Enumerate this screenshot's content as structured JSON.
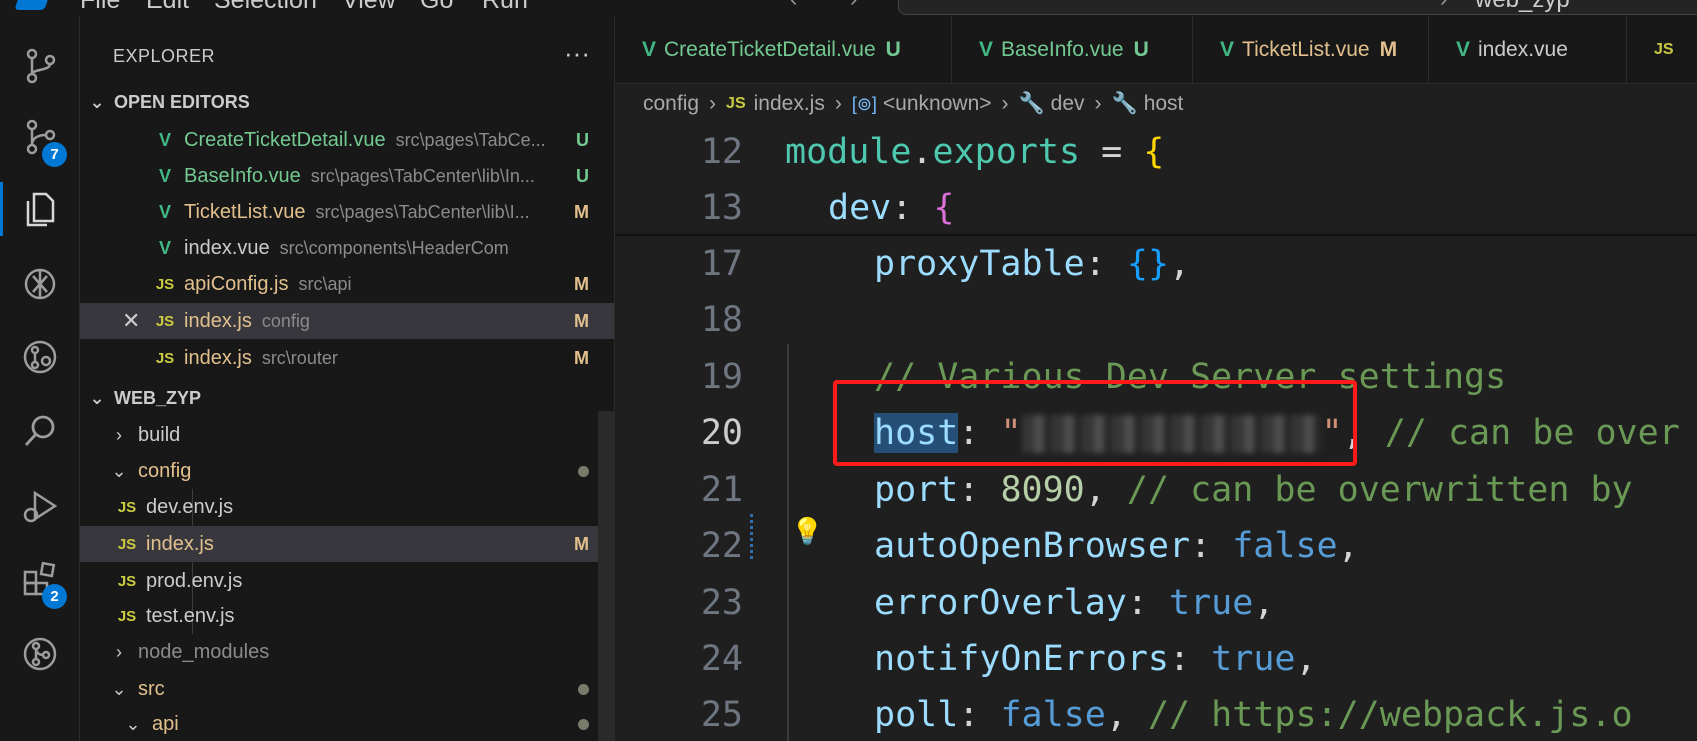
{
  "menu": {
    "items": [
      "File",
      "Edit",
      "Selection",
      "View",
      "Go",
      "Run"
    ],
    "search_text": "web_zyp"
  },
  "activity_bar": {
    "items": [
      {
        "name": "source-control-graph-icon"
      },
      {
        "name": "source-control-icon",
        "badge": "7"
      },
      {
        "name": "explorer-icon",
        "active": true
      },
      {
        "name": "chatgpt-icon"
      },
      {
        "name": "git-lens-icon"
      },
      {
        "name": "search-icon"
      },
      {
        "name": "run-debug-icon"
      },
      {
        "name": "extensions-icon",
        "badge": "2"
      },
      {
        "name": "git-graph-icon"
      }
    ]
  },
  "sidebar": {
    "title": "EXPLORER",
    "more": "···",
    "open_editors": {
      "title": "OPEN EDITORS",
      "items": [
        {
          "name": "CreateTicketDetail.vue",
          "path": "src\\pages\\TabCe...",
          "status": "U",
          "type": "vue"
        },
        {
          "name": "BaseInfo.vue",
          "path": "src\\pages\\TabCenter\\lib\\In...",
          "status": "U",
          "type": "vue"
        },
        {
          "name": "TicketList.vue",
          "path": "src\\pages\\TabCenter\\lib\\I...",
          "status": "M",
          "type": "vue"
        },
        {
          "name": "index.vue",
          "path": "src\\components\\HeaderCom",
          "status": "",
          "type": "vue"
        },
        {
          "name": "apiConfig.js",
          "path": "src\\api",
          "status": "M",
          "type": "js"
        },
        {
          "name": "index.js",
          "path": "config",
          "status": "M",
          "type": "js",
          "active": true
        },
        {
          "name": "index.js",
          "path": "src\\router",
          "status": "M",
          "type": "js"
        }
      ]
    },
    "workspace": {
      "title": "WEB_ZYP",
      "items": [
        {
          "label": "build",
          "kind": "folder-closed"
        },
        {
          "label": "config",
          "kind": "folder-open"
        },
        {
          "label": "dev.env.js",
          "kind": "js"
        },
        {
          "label": "index.js",
          "kind": "js",
          "status": "M"
        },
        {
          "label": "prod.env.js",
          "kind": "js"
        },
        {
          "label": "test.env.js",
          "kind": "js"
        },
        {
          "label": "node_modules",
          "kind": "folder-closed"
        },
        {
          "label": "src",
          "kind": "folder-open"
        },
        {
          "label": "api",
          "kind": "folder-open"
        }
      ]
    }
  },
  "tabs": [
    {
      "label": "CreateTicketDetail.vue",
      "status": "U"
    },
    {
      "label": "BaseInfo.vue",
      "status": "U"
    },
    {
      "label": "TicketList.vue",
      "status": "M"
    },
    {
      "label": "index.vue",
      "status": ""
    },
    {
      "label": "JS",
      "status": ""
    }
  ],
  "breadcrumb": {
    "folder": "config",
    "file": "index.js",
    "symbol": "<unknown>",
    "key1": "dev",
    "key2": "host",
    "js_badge": "JS",
    "symbol_badge": "[⊚]"
  },
  "code": {
    "lines": [
      {
        "n": "12"
      },
      {
        "n": "13"
      },
      {
        "n": "17"
      },
      {
        "n": "18"
      },
      {
        "n": "19"
      },
      {
        "n": "20"
      },
      {
        "n": "21"
      },
      {
        "n": "22"
      },
      {
        "n": "23"
      },
      {
        "n": "24"
      },
      {
        "n": "25"
      }
    ],
    "t": {
      "module": "module",
      "dot": ".",
      "exports": "exports",
      "eq": " = ",
      "brace_open": "{",
      "dev": "dev",
      "colon": ": ",
      "proxyTable": "proxyTable",
      "empty_obj": "{}",
      "comma": ",",
      "comment19": "// Various Dev Server settings",
      "host": "host",
      "quote": "\"",
      "host_comment": " // can be over",
      "port": "port",
      "port_val": "8090",
      "port_comment": " // can be overwritten by",
      "autoOpenBrowser": "autoOpenBrowser",
      "false": "false",
      "errorOverlay": "errorOverlay",
      "true": "true",
      "notifyOnErrors": "notifyOnErrors",
      "poll": "poll",
      "poll_comment": " // https://webpack.js.o"
    }
  },
  "colors": {
    "accent": "#0078d4",
    "highlight_box": "#ff1a1a"
  }
}
